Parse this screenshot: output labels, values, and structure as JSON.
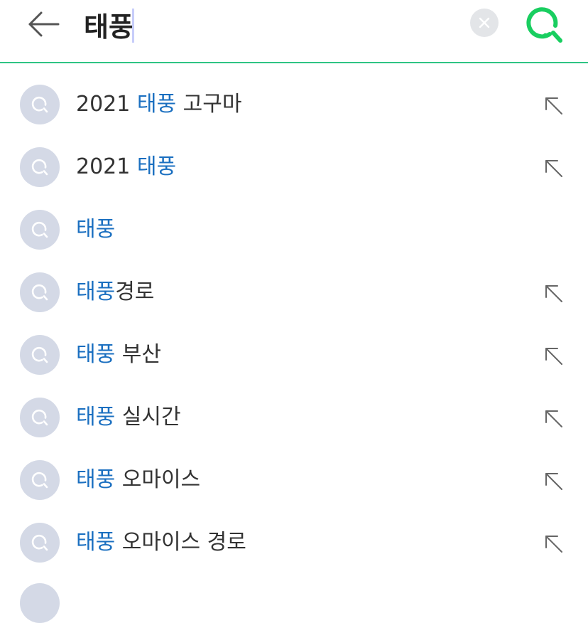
{
  "search": {
    "query": "태풍",
    "placeholder": ""
  },
  "icons": {
    "back": "back-arrow-icon",
    "clear": "close-icon",
    "search": "search-icon",
    "suggestion": "search-icon",
    "fill": "arrow-up-left-icon"
  },
  "colors": {
    "accent": "#2fc484",
    "highlight": "#1a6fc0",
    "text": "#333333",
    "icon_bg": "#d4d9e6"
  },
  "suggestions": [
    {
      "prefix": "2021 ",
      "highlight": "태풍",
      "suffix": " 고구마",
      "has_fill": true
    },
    {
      "prefix": "2021 ",
      "highlight": "태풍",
      "suffix": "",
      "has_fill": true
    },
    {
      "prefix": "",
      "highlight": "태풍",
      "suffix": "",
      "has_fill": false
    },
    {
      "prefix": "",
      "highlight": "태풍",
      "suffix": "경로",
      "has_fill": true
    },
    {
      "prefix": "",
      "highlight": "태풍",
      "suffix": " 부산",
      "has_fill": true
    },
    {
      "prefix": "",
      "highlight": "태풍",
      "suffix": " 실시간",
      "has_fill": true
    },
    {
      "prefix": "",
      "highlight": "태풍",
      "suffix": " 오마이스",
      "has_fill": true
    },
    {
      "prefix": "",
      "highlight": "태풍",
      "suffix": " 오마이스 경로",
      "has_fill": true
    }
  ]
}
